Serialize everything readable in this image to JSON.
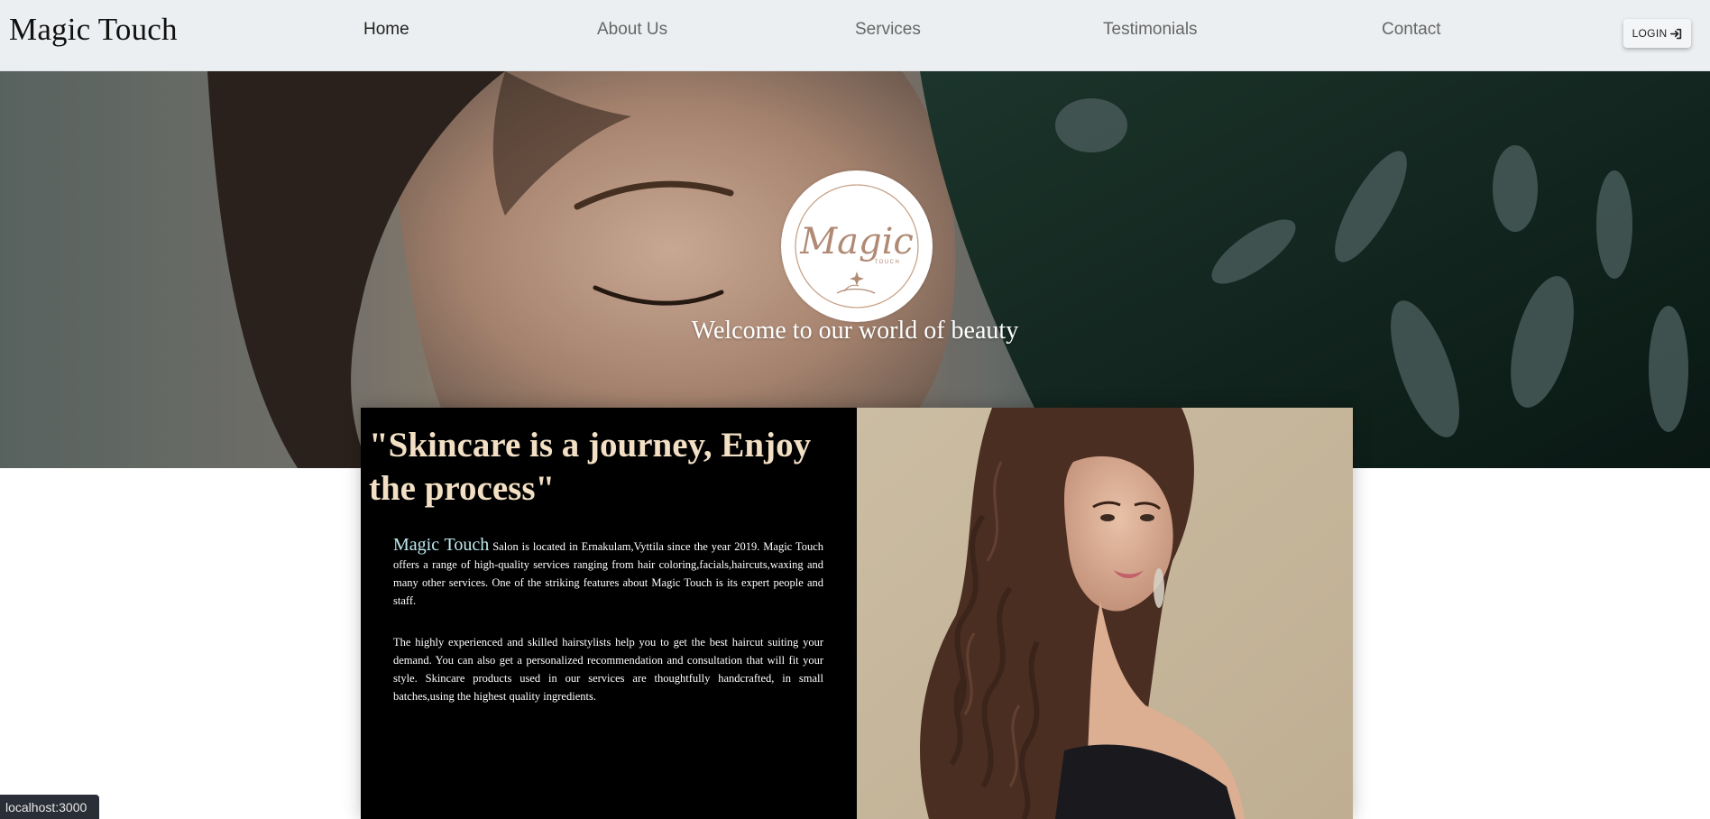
{
  "navbar": {
    "brand": "Magic Touch",
    "links": [
      {
        "label": "Home",
        "active": true
      },
      {
        "label": "About Us",
        "active": false
      },
      {
        "label": "Services",
        "active": false
      },
      {
        "label": "Testimonials",
        "active": false
      },
      {
        "label": "Contact",
        "active": false
      }
    ],
    "login_label": "LOGIN",
    "login_icon": "sign-in-icon"
  },
  "hero": {
    "logo_text": "Magic",
    "logo_subtext": "TOUCH",
    "welcome": "Welcome to our world of beauty"
  },
  "about": {
    "quote": "\"Skincare is a journey, Enjoy the process\"",
    "brand_inline": "Magic Touch",
    "paragraph1_rest": " Salon is located in Ernakulam,Vyttila since the year 2019. Magic Touch offers a range of high-quality services ranging from hair coloring,facials,haircuts,waxing and many other services. One of the striking features about Magic Touch is its expert people and staff.",
    "paragraph2": "The highly experienced and skilled hairstylists help you to get the best haircut suiting your demand. You can also get a personalized recommendation and consultation that will fit your style. Skincare products used in our services are thoughtfully handcrafted, in small batches,using the highest quality ingredients."
  },
  "status_bar": {
    "url": "localhost:3000"
  },
  "colors": {
    "navbar_bg": "#eceff1",
    "quote_color": "#f2dfc4",
    "brand_inline_color": "#bfe9ef",
    "about_left_bg": "#000000",
    "about_right_bg": "#c9baa0"
  }
}
